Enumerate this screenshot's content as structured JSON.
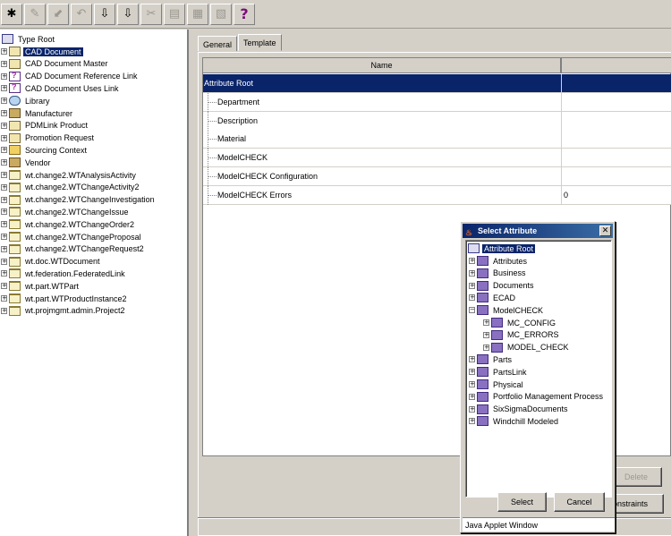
{
  "toolbar": {
    "buttons": [
      {
        "icon": "new-icon",
        "glyph": "✱",
        "enabled": true
      },
      {
        "icon": "edit-icon",
        "glyph": "✎",
        "enabled": false
      },
      {
        "icon": "check-in-icon",
        "glyph": "⬋",
        "enabled": false
      },
      {
        "icon": "undo-icon",
        "glyph": "↶",
        "enabled": false
      },
      {
        "icon": "check-out-icon",
        "glyph": "⇩",
        "enabled": true
      },
      {
        "icon": "check-out-alt-icon",
        "glyph": "⇩",
        "enabled": true
      },
      {
        "icon": "cut-icon",
        "glyph": "✂",
        "enabled": false
      },
      {
        "icon": "copy-icon",
        "glyph": "▤",
        "enabled": false
      },
      {
        "icon": "paste-icon",
        "glyph": "▦",
        "enabled": false
      },
      {
        "icon": "properties-icon",
        "glyph": "▧",
        "enabled": false
      },
      {
        "icon": "help-icon",
        "glyph": "?",
        "enabled": true
      }
    ]
  },
  "type_tree": {
    "root": "Type Root",
    "items": [
      {
        "label": "CAD Document",
        "icon": "cad-document-icon",
        "kind": "doc",
        "selected": true
      },
      {
        "label": "CAD Document Master",
        "icon": "cad-master-icon",
        "kind": "doc"
      },
      {
        "label": "CAD Document Reference Link",
        "icon": "link-icon",
        "kind": "mag"
      },
      {
        "label": "CAD Document Uses Link",
        "icon": "link-icon",
        "kind": "mag"
      },
      {
        "label": "Library",
        "icon": "library-icon",
        "kind": "lib"
      },
      {
        "label": "Manufacturer",
        "icon": "manufacturer-icon",
        "kind": "factory"
      },
      {
        "label": "PDMLink Product",
        "icon": "product-icon",
        "kind": "doc"
      },
      {
        "label": "Promotion Request",
        "icon": "promotion-icon",
        "kind": "doc"
      },
      {
        "label": "Sourcing Context",
        "icon": "sourcing-icon",
        "kind": "arrow"
      },
      {
        "label": "Vendor",
        "icon": "vendor-icon",
        "kind": "factory"
      },
      {
        "label": "wt.change2.WTAnalysisActivity",
        "icon": "folder-icon",
        "kind": "folder"
      },
      {
        "label": "wt.change2.WTChangeActivity2",
        "icon": "folder-icon",
        "kind": "folder"
      },
      {
        "label": "wt.change2.WTChangeInvestigation",
        "icon": "folder-icon",
        "kind": "folder"
      },
      {
        "label": "wt.change2.WTChangeIssue",
        "icon": "folder-icon",
        "kind": "folder"
      },
      {
        "label": "wt.change2.WTChangeOrder2",
        "icon": "folder-icon",
        "kind": "folder"
      },
      {
        "label": "wt.change2.WTChangeProposal",
        "icon": "folder-icon",
        "kind": "folder"
      },
      {
        "label": "wt.change2.WTChangeRequest2",
        "icon": "folder-icon",
        "kind": "folder"
      },
      {
        "label": "wt.doc.WTDocument",
        "icon": "folder-icon",
        "kind": "folder"
      },
      {
        "label": "wt.federation.FederatedLink",
        "icon": "folder-icon",
        "kind": "folder"
      },
      {
        "label": "wt.part.WTPart",
        "icon": "folder-icon",
        "kind": "folder"
      },
      {
        "label": "wt.part.WTProductInstance2",
        "icon": "folder-icon",
        "kind": "folder"
      },
      {
        "label": "wt.projmgmt.admin.Project2",
        "icon": "folder-icon",
        "kind": "folder"
      }
    ]
  },
  "tabs": [
    {
      "label": "General",
      "active": false
    },
    {
      "label": "Template",
      "active": true
    }
  ],
  "attr_table": {
    "header_name": "Name",
    "rows": [
      {
        "name": "Attribute Root",
        "value": "",
        "selected": true,
        "child": false
      },
      {
        "name": "Department",
        "value": "",
        "child": true
      },
      {
        "name": "Description",
        "value": "",
        "child": true
      },
      {
        "name": "Material",
        "value": "",
        "child": true
      },
      {
        "name": "ModelCHECK",
        "value": "",
        "child": true
      },
      {
        "name": "ModelCHECK Configuration",
        "value": "",
        "child": true
      },
      {
        "name": "ModelCHECK Errors",
        "value": "0",
        "child": true
      }
    ]
  },
  "buttons": {
    "delete": "Delete",
    "constraints": "onstraints"
  },
  "dialog": {
    "title": "Select Attribute",
    "close": "✕",
    "root": "Attribute Root",
    "items": [
      {
        "label": "Attributes",
        "indent": 0,
        "expanded": false
      },
      {
        "label": "Business",
        "indent": 0,
        "expanded": false
      },
      {
        "label": "Documents",
        "indent": 0,
        "expanded": false
      },
      {
        "label": "ECAD",
        "indent": 0,
        "expanded": false
      },
      {
        "label": "ModelCHECK",
        "indent": 0,
        "expanded": true
      },
      {
        "label": "MC_CONFIG",
        "indent": 1,
        "expanded": false
      },
      {
        "label": "MC_ERRORS",
        "indent": 1,
        "expanded": false
      },
      {
        "label": "MODEL_CHECK",
        "indent": 1,
        "expanded": false
      },
      {
        "label": "Parts",
        "indent": 0,
        "expanded": false
      },
      {
        "label": "PartsLink",
        "indent": 0,
        "expanded": false
      },
      {
        "label": "Physical",
        "indent": 0,
        "expanded": false
      },
      {
        "label": "Portfolio Management Process",
        "indent": 0,
        "expanded": false
      },
      {
        "label": "SixSigmaDocuments",
        "indent": 0,
        "expanded": false
      },
      {
        "label": "Windchill Modeled",
        "indent": 0,
        "expanded": false
      }
    ],
    "select_label": "Select",
    "cancel_label": "Cancel",
    "footer": "Java Applet Window"
  }
}
